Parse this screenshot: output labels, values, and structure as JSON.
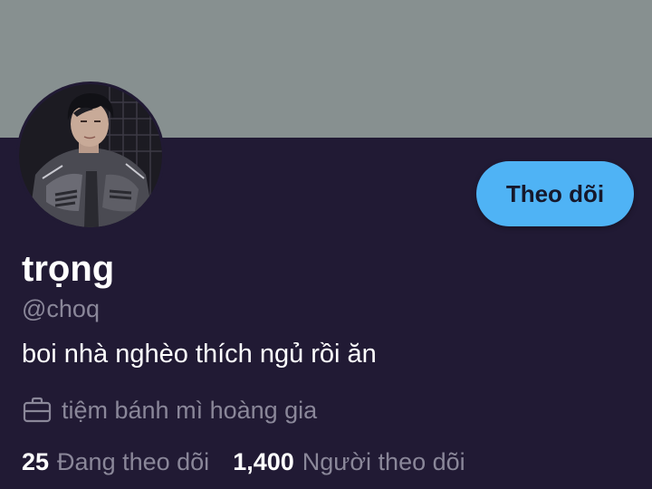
{
  "profile": {
    "display_name": "trọng",
    "handle": "@choq",
    "bio": "boi nhà nghèo thích ngủ rồi ăn",
    "work": "tiệm bánh mì hoàng gia",
    "follow_button_label": "Theo dõi"
  },
  "stats": {
    "following_count": "25",
    "following_label": "Đang theo dõi",
    "followers_count": "1,400",
    "followers_label": "Người theo dõi"
  },
  "colors": {
    "banner": "#879090",
    "background": "#211a34",
    "accent": "#4fb3f5",
    "muted_text": "#8a8799"
  },
  "icons": {
    "work": "briefcase-icon"
  }
}
